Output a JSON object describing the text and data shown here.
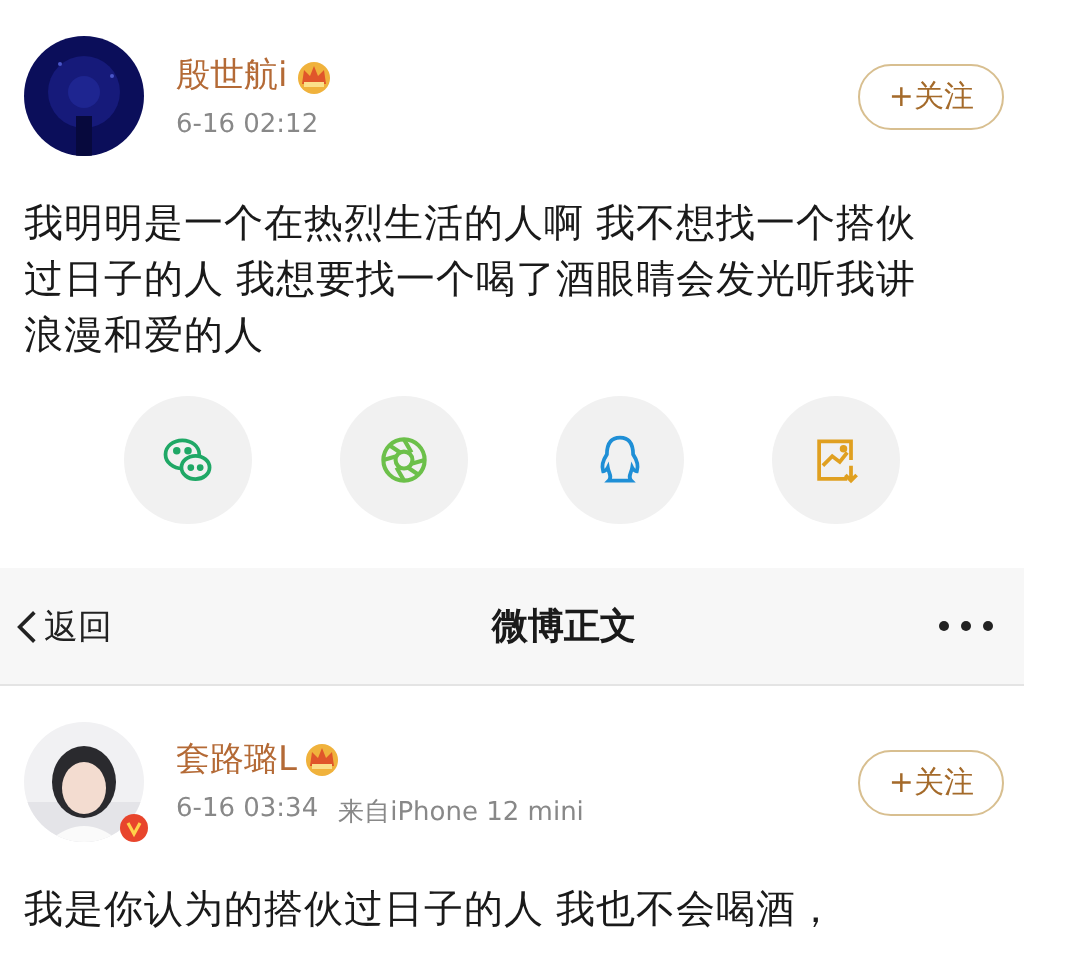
{
  "top_post": {
    "user": {
      "name": "殷世航i",
      "verified": false
    },
    "time": "6-16 02:12",
    "follow_label": "+关注",
    "text": "我明明是一个在热烈生活的人啊 我不想找一个搭伙过日子的人 我想要找一个喝了酒眼睛会发光听我讲浪漫和爱的人"
  },
  "share_targets": [
    {
      "kind": "wechat"
    },
    {
      "kind": "moments"
    },
    {
      "kind": "qq"
    },
    {
      "kind": "save-image"
    }
  ],
  "nav_bar": {
    "back_label": "返回",
    "title": "微博正文"
  },
  "bottom_post": {
    "user": {
      "name": "套路璐L",
      "verified": true
    },
    "time": "6-16 03:34",
    "source": "来自iPhone 12 mini",
    "follow_label": "+关注",
    "text": "我是你认为的搭伙过日子的人  我也不会喝酒，"
  }
}
